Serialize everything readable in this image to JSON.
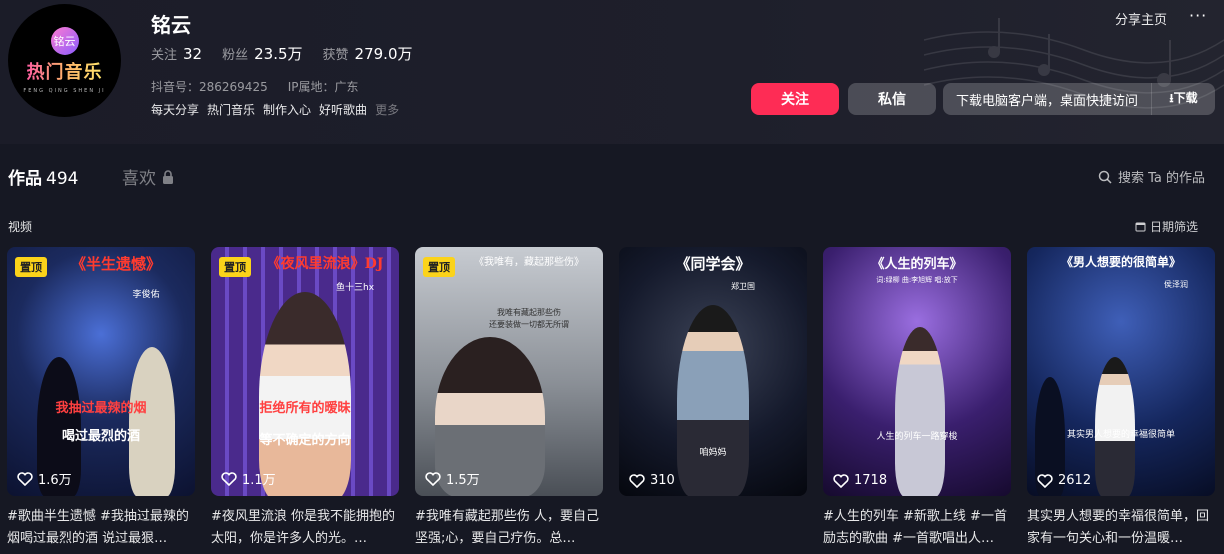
{
  "profile": {
    "name": "铭云",
    "avatar": {
      "badge": "铭云",
      "title": "热门音乐",
      "sub": "FENG QING SHEN JI"
    },
    "stats": [
      {
        "label": "关注",
        "value": "32"
      },
      {
        "label": "粉丝",
        "value": "23.5万"
      },
      {
        "label": "获赞",
        "value": "279.0万"
      }
    ],
    "douyin_id": "抖音号：286269425",
    "ip": "IP属地：广东",
    "bio": [
      "每天分享",
      "热门音乐",
      "制作入心",
      "好听歌曲"
    ],
    "bio_more": "更多"
  },
  "header_actions": {
    "share": "分享主页",
    "more": "···"
  },
  "buttons": {
    "follow": "关注",
    "message": "私信",
    "download_text": "下载电脑客户端，桌面快捷访问",
    "download_action": "下载"
  },
  "tabs": {
    "works_label": "作品",
    "works_count": "494",
    "likes_label": "喜欢",
    "search_label": "搜索 Ta 的作品"
  },
  "section": {
    "label": "视频",
    "filter": "日期筛选"
  },
  "videos": [
    {
      "pinned": "置顶",
      "title": "《半生遗憾》",
      "overlay1": "我抽过最辣的烟",
      "overlay2": "喝过最烈的酒",
      "singer": "李俊佑",
      "likes": "1.6万",
      "caption": "#歌曲半生遗憾 #我抽过最辣的烟喝过最烈的酒 说过最狠…",
      "color": "#1b2a5e"
    },
    {
      "pinned": "置顶",
      "title": "《夜风里流浪》DJ",
      "overlay1": "拒绝所有的暧昧",
      "overlay2": "等不确定的方向",
      "singer": "鱼十三hx",
      "likes": "1.1万",
      "caption": "#夜风里流浪 你是我不能拥抱的太阳，你是许多人的光。…",
      "color": "#2b1447"
    },
    {
      "pinned": "置顶",
      "title": "《我唯有，藏起那些伤》",
      "overlay1": "我唯有藏起那些伤",
      "overlay2": "还要装做一切都无所谓",
      "singer": "",
      "likes": "1.5万",
      "caption": "#我唯有藏起那些伤 人，要自己坚强;心，要自己疗伤。总…",
      "color": "#4a4f56"
    },
    {
      "pinned": "",
      "title": "《同学会》",
      "overlay1": "",
      "overlay2": "咱妈妈",
      "singer": "郑卫国",
      "likes": "310",
      "caption": "",
      "color": "#0f1220"
    },
    {
      "pinned": "",
      "title": "《人生的列车》",
      "overlay1": "",
      "overlay2": "人生的列车一路穿梭",
      "singer": "词:绿柳  曲:李旭辉  唱:放下",
      "likes": "1718",
      "caption": "#人生的列车 #新歌上线 #一首励志的歌曲 #一首歌唱出人…",
      "color": "#3a1f6e"
    },
    {
      "pinned": "",
      "title": "《男人想要的很简单》",
      "overlay1": "",
      "overlay2": "其实男人想要的幸福很简单",
      "singer": "侯泽润",
      "likes": "2612",
      "caption": "其实男人想要的幸福很简单，回家有一句关心和一份温暖…",
      "color": "#15275e"
    }
  ],
  "colors": {
    "accent": "#fe2c55",
    "pin": "#fbd31a",
    "background": "#161823"
  }
}
